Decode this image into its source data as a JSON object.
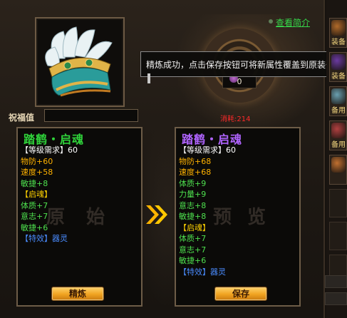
{
  "header": {
    "view_intro_label": "查看简介"
  },
  "item": {
    "icon": "lotus-crown-shoes-icon"
  },
  "blessing": {
    "label": "祝福值",
    "value": ""
  },
  "refine": {
    "tooltip": "精炼成功，点击保存按钮可将新属性覆盖到原装备上",
    "material_count": "0",
    "cost": "消耗:214"
  },
  "original_panel": {
    "title": "踏鹤・启魂",
    "watermark": [
      "原",
      "始"
    ],
    "button_label": "精炼",
    "lines": [
      {
        "text": "【等级需求】60",
        "color": "#ffffff"
      },
      {
        "text": "物防+60",
        "color": "#ffb200"
      },
      {
        "text": "速度+58",
        "color": "#ffb200"
      },
      {
        "text": "敏捷+8",
        "color": "#4ee04e"
      },
      {
        "text": "【启魂】",
        "color": "#ffd200"
      },
      {
        "text": "体质+7",
        "color": "#4ee04e"
      },
      {
        "text": "意志+7",
        "color": "#4ee04e"
      },
      {
        "text": "敏捷+6",
        "color": "#4ee04e"
      },
      {
        "text": "【特效】器灵",
        "color": "#4a8cff"
      }
    ]
  },
  "preview_panel": {
    "title": "踏鹤・启魂",
    "watermark": [
      "预",
      "览"
    ],
    "button_label": "保存",
    "lines": [
      {
        "text": "【等级需求】60",
        "color": "#ffffff"
      },
      {
        "text": "物防+68",
        "color": "#ffb200"
      },
      {
        "text": "速度+68",
        "color": "#ffb200"
      },
      {
        "text": "体质+9",
        "color": "#4ee04e"
      },
      {
        "text": "力量+9",
        "color": "#4ee04e"
      },
      {
        "text": "意志+8",
        "color": "#4ee04e"
      },
      {
        "text": "敏捷+8",
        "color": "#4ee04e"
      },
      {
        "text": "【启魂】",
        "color": "#ffd200"
      },
      {
        "text": "体质+7",
        "color": "#4ee04e"
      },
      {
        "text": "意志+7",
        "color": "#4ee04e"
      },
      {
        "text": "敏捷+6",
        "color": "#4ee04e"
      },
      {
        "text": "【特效】器灵",
        "color": "#4a8cff"
      }
    ]
  },
  "sidebar": {
    "tabs": [
      {
        "label": "装备",
        "icon": "equipment-tab-icon",
        "color": "#b06a2a"
      },
      {
        "label": "装备",
        "icon": "equipment-tab-icon",
        "color": "#6a3aa0"
      },
      {
        "label": "备用",
        "icon": "spare-tab-icon",
        "color": "#6aa0b0"
      },
      {
        "label": "备用",
        "icon": "spare-tab-icon",
        "color": "#b04040"
      },
      {
        "label": "",
        "icon": "spare-tab-icon",
        "color": "#c07030"
      }
    ]
  }
}
